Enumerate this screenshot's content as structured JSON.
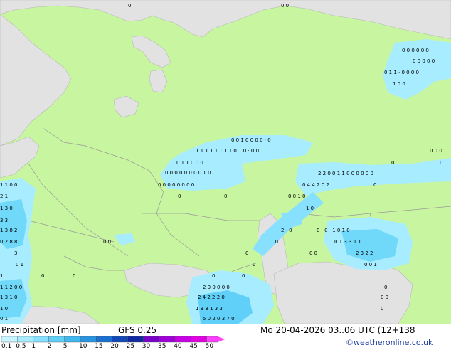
{
  "title": "Precipitation [mm]",
  "model": "GFS 0.25",
  "valid_time": "Mo 20-04-2026 03..06 UTC (12+138",
  "credit": "©weatheronline.co.uk",
  "legend": {
    "ticks": [
      "0.1",
      "0.5",
      "1",
      "2",
      "5",
      "10",
      "15",
      "20",
      "25",
      "30",
      "35",
      "40",
      "45",
      "50"
    ],
    "colors": [
      "#c8f5ff",
      "#a8ecff",
      "#88e0ff",
      "#60d0f8",
      "#40b8f0",
      "#2894e0",
      "#1870d0",
      "#1048b8",
      "#1028a0",
      "#7800c8",
      "#a000d8",
      "#c800e8",
      "#e000e0",
      "#ff40ff"
    ]
  },
  "colors": {
    "land": "#c8f5a0",
    "sea": "#e2e2e2",
    "precip_light": "#a8ecff",
    "precip_medium": "#70d8f8",
    "precip_heavy": "#40b0e8",
    "border": "#a0a0a0"
  }
}
